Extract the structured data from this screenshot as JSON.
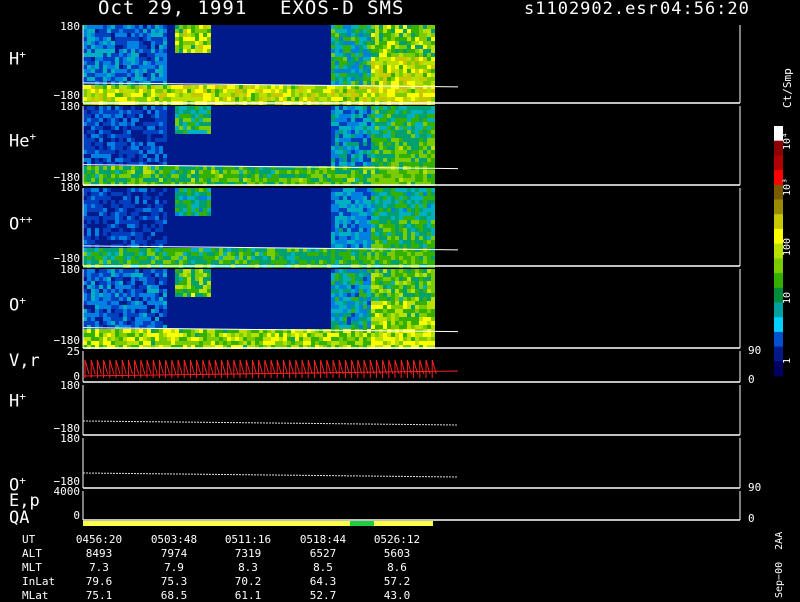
{
  "header": {
    "date": "Oct 29, 1991",
    "instrument": "EXOS-D SMS",
    "file": "s1102902.esr",
    "start_time": "04:56:20"
  },
  "panels": [
    {
      "name": "H",
      "sup": "+",
      "tick_top": "180",
      "tick_bottom": "−180"
    },
    {
      "name": "He",
      "sup": "+",
      "tick_top": "180",
      "tick_bottom": "−180"
    },
    {
      "name": "O",
      "sup": "++",
      "tick_top": "180",
      "tick_bottom": "−180"
    },
    {
      "name": "O",
      "sup": "+",
      "tick_top": "180",
      "tick_bottom": "−180"
    },
    {
      "name": "V,r",
      "sup": "",
      "tick_top": "25",
      "tick_bottom": "0",
      "right_top": "90",
      "right_bottom": "0"
    },
    {
      "name": "H",
      "sup": "+",
      "tick_top": "180",
      "tick_bottom": "−180"
    },
    {
      "name": "O",
      "sup": "+",
      "tick_top": "180",
      "tick_bottom": "−180"
    },
    {
      "name": "E,p",
      "sup": "",
      "tick_top": "4000",
      "tick_bottom": "",
      "right_top": "90"
    },
    {
      "name": "QA",
      "sup": "",
      "tick_top": "0",
      "tick_bottom": "",
      "right_bottom": "0"
    }
  ],
  "colorbar": {
    "label": "Ct/Smp",
    "ticks": [
      "10⁴",
      "10³",
      "100",
      "10",
      "1"
    ],
    "colors": [
      "#ffffff",
      "#8b0000",
      "#b00000",
      "#ff0000",
      "#7a5a00",
      "#9a8a00",
      "#c8c800",
      "#ffff00",
      "#b8e000",
      "#7acc00",
      "#33b000",
      "#008c3a",
      "#00a0a0",
      "#00d0ff",
      "#0050d0",
      "#001a8c",
      "#000060"
    ]
  },
  "ephemeris": {
    "rows": [
      {
        "label": "UT",
        "values": [
          "0456:20",
          "0503:48",
          "0511:16",
          "0518:44",
          "0526:12"
        ]
      },
      {
        "label": "ALT",
        "values": [
          "8493",
          "7974",
          "7319",
          "6527",
          "5603"
        ]
      },
      {
        "label": "MLT",
        "values": [
          "7.3",
          "7.9",
          "8.3",
          "8.5",
          "8.6"
        ]
      },
      {
        "label": "InLat",
        "values": [
          "79.6",
          "75.3",
          "70.2",
          "64.3",
          "57.2"
        ]
      },
      {
        "label": "MLat",
        "values": [
          "75.1",
          "68.5",
          "61.1",
          "52.7",
          "43.0"
        ]
      }
    ]
  },
  "stamp": "Sep−00  2AA",
  "chart_data": {
    "type": "heatmap",
    "title": "Oct 29, 1991   EXOS-D SMS",
    "x_ticks": [
      "0456:20",
      "0503:48",
      "0511:16",
      "0518:44",
      "0526:12"
    ],
    "y_range": [
      -180,
      180
    ],
    "color_scale": "log",
    "color_range": [
      1,
      10000
    ],
    "colorbar_label": "Ct/Smp",
    "series": [
      {
        "name": "H+",
        "band_intensity": "high"
      },
      {
        "name": "He+",
        "band_intensity": "medium"
      },
      {
        "name": "O++",
        "band_intensity": "medium"
      },
      {
        "name": "O+",
        "band_intensity": "high"
      }
    ],
    "qa_segments": [
      {
        "x_start": "0456:20",
        "x_end": "0520:30",
        "color": "#ffff44"
      },
      {
        "x_start": "0520:30",
        "x_end": "0522:00",
        "color": "#22cc44"
      },
      {
        "x_start": "0522:00",
        "x_end": "0527:00",
        "color": "#ffff44"
      }
    ]
  }
}
